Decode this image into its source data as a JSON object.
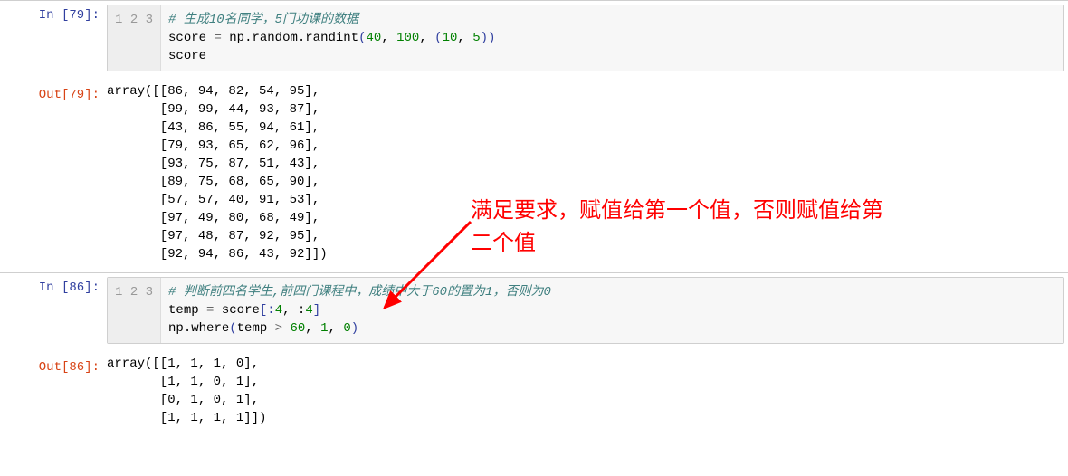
{
  "cell1": {
    "in_label": "In [79]:",
    "out_label": "Out[79]:",
    "line1_comment": "# 生成10名同学，5门功课的数据",
    "line2_a": "score ",
    "line2_op": "= ",
    "line2_b": "np.random.randint",
    "line2_paren1": "(",
    "line2_n1": "40",
    "line2_c1": ", ",
    "line2_n2": "100",
    "line2_c2": ", ",
    "line2_paren2": "(",
    "line2_n3": "10",
    "line2_c3": ", ",
    "line2_n4": "5",
    "line2_paren3": "))",
    "line3": "score",
    "ln1": "1",
    "ln2": "2",
    "ln3": "3",
    "output": "array([[86, 94, 82, 54, 95],\n       [99, 99, 44, 93, 87],\n       [43, 86, 55, 94, 61],\n       [79, 93, 65, 62, 96],\n       [93, 75, 87, 51, 43],\n       [89, 75, 68, 65, 90],\n       [57, 57, 40, 91, 53],\n       [97, 49, 80, 68, 49],\n       [97, 48, 87, 92, 95],\n       [92, 94, 86, 43, 92]])"
  },
  "cell2": {
    "in_label": "In [86]:",
    "out_label": "Out[86]:",
    "line1_comment": "# 判断前四名学生,前四门课程中，成绩中大于60的置为1，否则为0",
    "line2_a": "temp ",
    "line2_op": "= ",
    "line2_b": "score",
    "line2_paren1": "[:",
    "line2_n1": "4",
    "line2_c1": ", :",
    "line2_n2": "4",
    "line2_paren2": "]",
    "line3_a": "np.where",
    "line3_paren1": "(",
    "line3_b": "temp ",
    "line3_op": "> ",
    "line3_n1": "60",
    "line3_c1": ", ",
    "line3_n2": "1",
    "line3_c2": ", ",
    "line3_n3": "0",
    "line3_paren2": ")",
    "ln1": "1",
    "ln2": "2",
    "ln3": "3",
    "output": "array([[1, 1, 1, 0],\n       [1, 1, 0, 1],\n       [0, 1, 0, 1],\n       [1, 1, 1, 1]])"
  },
  "annotation": {
    "line1": "满足要求，赋值给第一个值，否则赋值给第",
    "line2": "二个值"
  }
}
